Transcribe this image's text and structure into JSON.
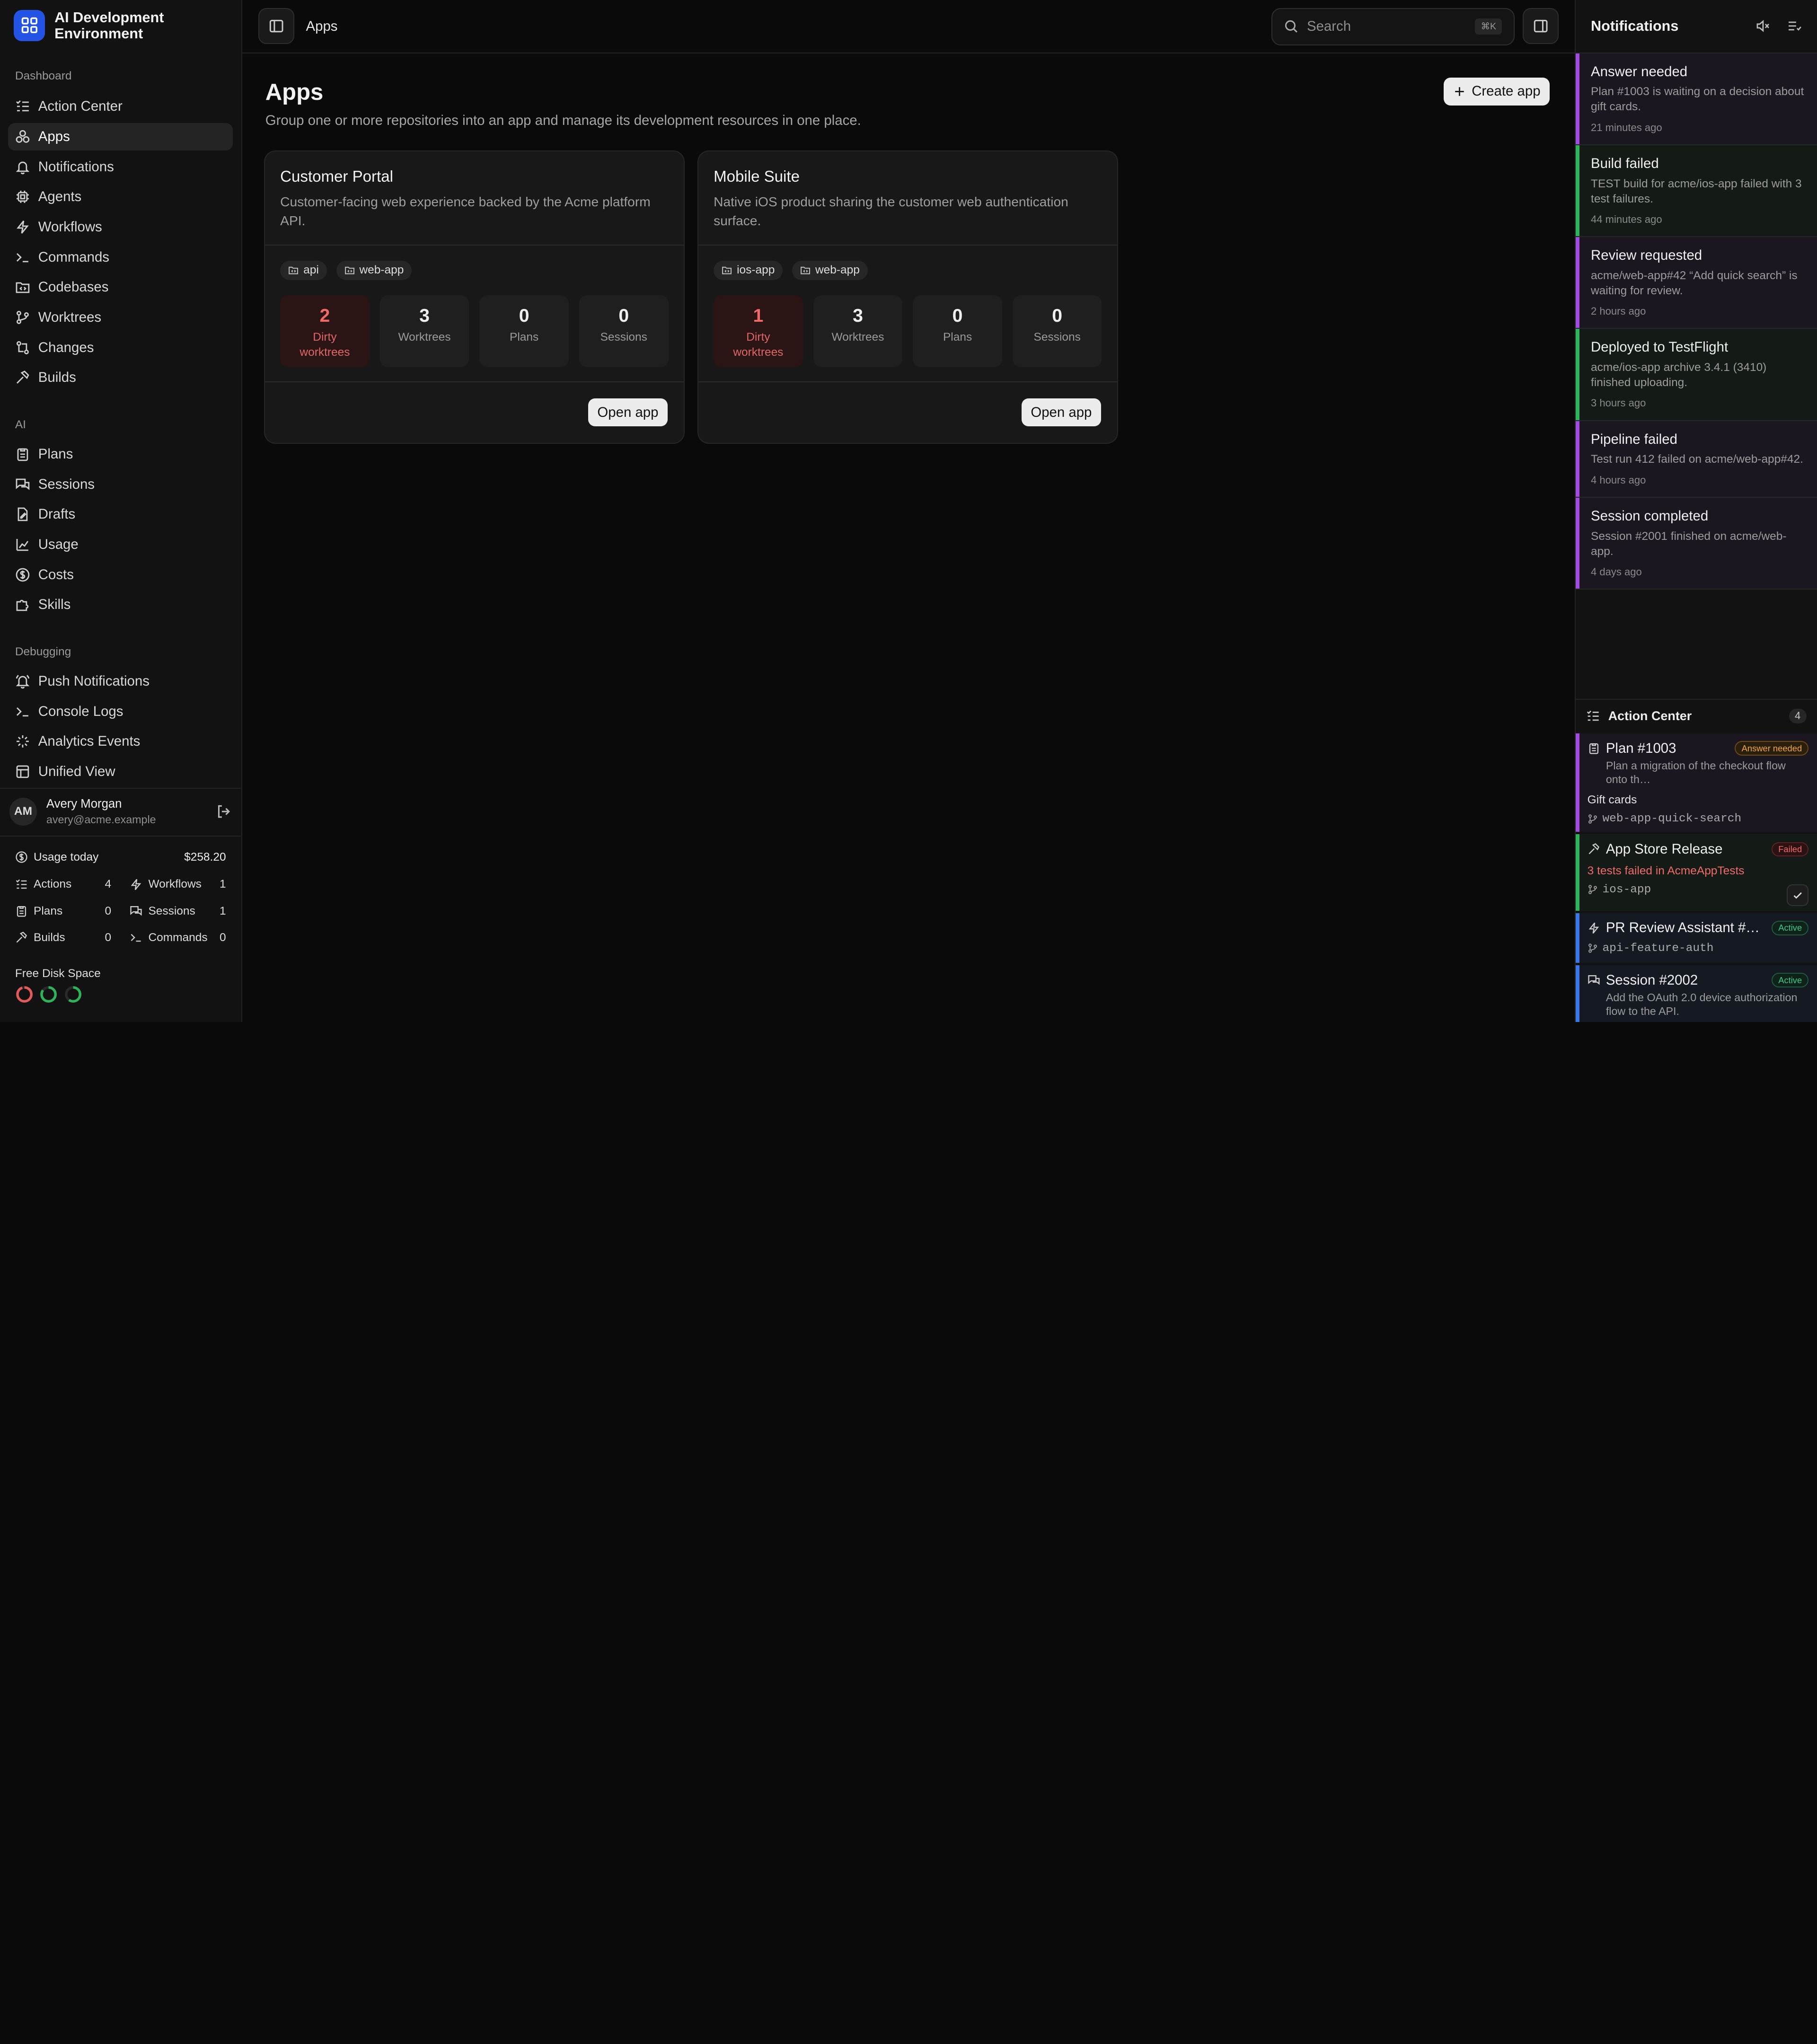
{
  "brand": {
    "name": "AI Development Environment"
  },
  "sidebar": {
    "sections": [
      {
        "label": "Dashboard",
        "items": [
          {
            "label": "Action Center",
            "icon": "list-check-icon"
          },
          {
            "label": "Apps",
            "icon": "apps-icon",
            "active": true
          },
          {
            "label": "Notifications",
            "icon": "bell-icon"
          },
          {
            "label": "Agents",
            "icon": "cpu-icon"
          },
          {
            "label": "Workflows",
            "icon": "workflow-icon"
          },
          {
            "label": "Commands",
            "icon": "terminal-icon"
          },
          {
            "label": "Codebases",
            "icon": "folder-code-icon"
          },
          {
            "label": "Worktrees",
            "icon": "git-branch-icon"
          },
          {
            "label": "Changes",
            "icon": "git-compare-icon"
          },
          {
            "label": "Builds",
            "icon": "hammer-icon"
          }
        ]
      },
      {
        "label": "AI",
        "items": [
          {
            "label": "Plans",
            "icon": "clipboard-icon"
          },
          {
            "label": "Sessions",
            "icon": "chat-icon"
          },
          {
            "label": "Drafts",
            "icon": "file-edit-icon"
          },
          {
            "label": "Usage",
            "icon": "chart-icon"
          },
          {
            "label": "Costs",
            "icon": "dollar-icon"
          },
          {
            "label": "Skills",
            "icon": "puzzle-icon"
          }
        ]
      },
      {
        "label": "Debugging",
        "items": [
          {
            "label": "Push Notifications",
            "icon": "bell-ring-icon"
          },
          {
            "label": "Console Logs",
            "icon": "terminal-icon"
          },
          {
            "label": "Analytics Events",
            "icon": "sparkle-icon"
          },
          {
            "label": "Unified View",
            "icon": "layout-icon"
          }
        ]
      }
    ]
  },
  "user": {
    "initials": "AM",
    "name": "Avery Morgan",
    "email": "avery@acme.example"
  },
  "usage": {
    "label": "Usage today",
    "value": "$258.20",
    "stats": [
      {
        "label": "Actions",
        "value": "4"
      },
      {
        "label": "Workflows",
        "value": "1"
      },
      {
        "label": "Plans",
        "value": "0"
      },
      {
        "label": "Sessions",
        "value": "1"
      },
      {
        "label": "Builds",
        "value": "0"
      },
      {
        "label": "Commands",
        "value": "0"
      }
    ],
    "disk_label": "Free Disk Space",
    "disks": [
      {
        "fraction": 0.95,
        "color": "#e25a5a"
      },
      {
        "fraction": 0.85,
        "color": "#2fb35a"
      },
      {
        "fraction": 0.6,
        "color": "#2fb35a"
      }
    ]
  },
  "topbar": {
    "breadcrumb": "Apps",
    "search_placeholder": "Search",
    "shortcut": "⌘K"
  },
  "main": {
    "title": "Apps",
    "subtitle": "Group one or more repositories into an app and manage its development resources in one place.",
    "create_label": "Create app",
    "open_label": "Open app",
    "apps": [
      {
        "name": "Customer Portal",
        "description": "Customer-facing web experience backed by the Acme platform API.",
        "repos": [
          "api",
          "web-app"
        ],
        "metrics": [
          {
            "value": "2",
            "label": "Dirty worktrees"
          },
          {
            "value": "3",
            "label": "Worktrees"
          },
          {
            "value": "0",
            "label": "Plans"
          },
          {
            "value": "0",
            "label": "Sessions"
          }
        ]
      },
      {
        "name": "Mobile Suite",
        "description": "Native iOS product sharing the customer web authentication surface.",
        "repos": [
          "ios-app",
          "web-app"
        ],
        "metrics": [
          {
            "value": "1",
            "label": "Dirty worktrees"
          },
          {
            "value": "3",
            "label": "Worktrees"
          },
          {
            "value": "0",
            "label": "Plans"
          },
          {
            "value": "0",
            "label": "Sessions"
          }
        ]
      }
    ]
  },
  "notifications": {
    "title": "Notifications",
    "items": [
      {
        "title": "Answer needed",
        "body": "Plan #1003 is waiting on a decision about gift cards.",
        "time": "21 minutes ago",
        "accent": "purple"
      },
      {
        "title": "Build failed",
        "body": "TEST build for acme/ios-app failed with 3 test failures.",
        "time": "44 minutes ago",
        "accent": "green"
      },
      {
        "title": "Review requested",
        "body": "acme/web-app#42 “Add quick search” is waiting for review.",
        "time": "2 hours ago",
        "accent": "purple"
      },
      {
        "title": "Deployed to TestFlight",
        "body": "acme/ios-app archive 3.4.1 (3410) finished uploading.",
        "time": "3 hours ago",
        "accent": "green"
      },
      {
        "title": "Pipeline failed",
        "body": "Test run 412 failed on acme/web-app#42.",
        "time": "4 hours ago",
        "accent": "purple"
      },
      {
        "title": "Session completed",
        "body": "Session #2001 finished on acme/web-app.",
        "time": "4 days ago",
        "accent": "purple"
      }
    ]
  },
  "action_center": {
    "title": "Action Center",
    "count": "4",
    "items": [
      {
        "title": "Plan #1003",
        "badge": "Answer needed",
        "desc": "Plan a migration of the checkout flow onto th…",
        "sub": "Gift cards",
        "branch": "web-app-quick-search"
      },
      {
        "title": "App Store Release",
        "badge": "Failed",
        "error": "3 tests failed in AcmeAppTests",
        "branch": "ios-app"
      },
      {
        "title": "PR Review Assistant #4…",
        "badge": "Active",
        "branch": "api-feature-auth"
      },
      {
        "title": "Session #2002",
        "badge": "Active",
        "desc": "Add the OAuth 2.0 device authorization flow to the API."
      }
    ]
  }
}
